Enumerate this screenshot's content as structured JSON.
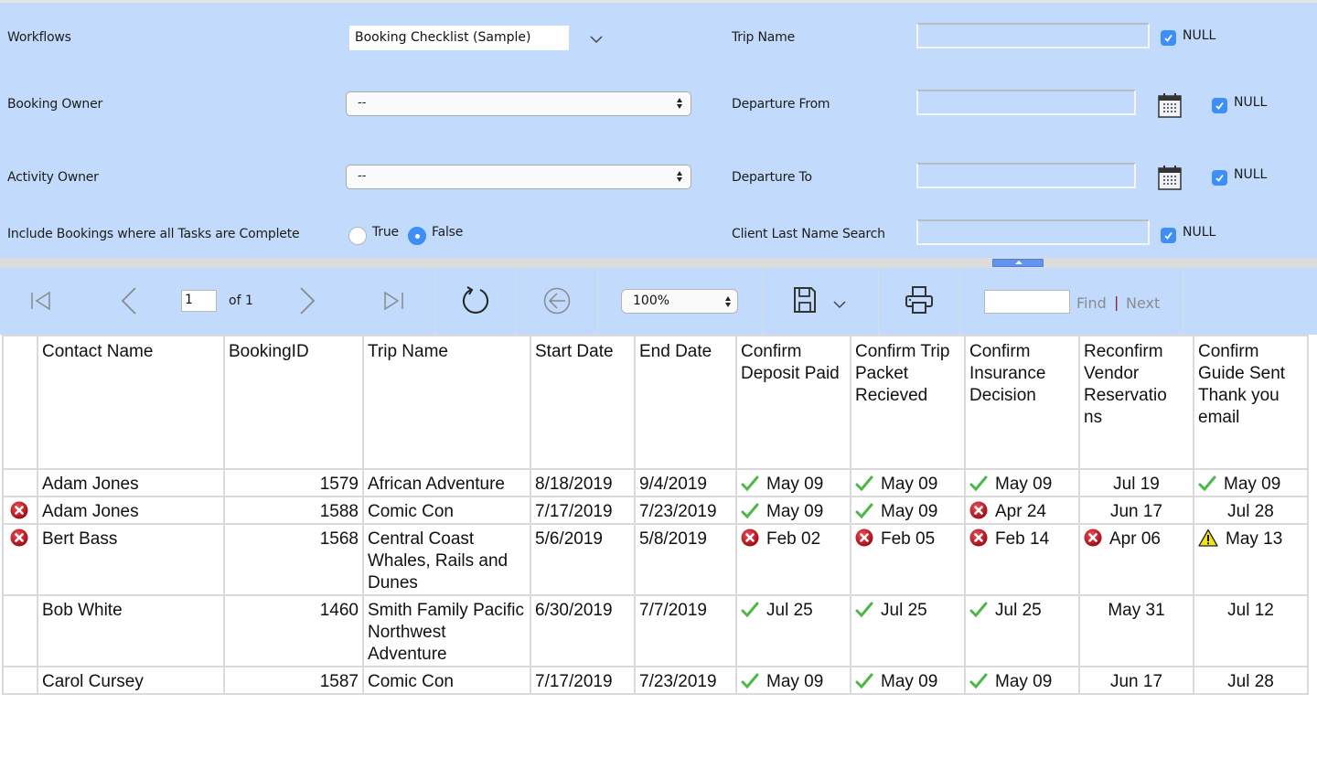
{
  "params": {
    "workflows": {
      "label": "Workflows",
      "value": "Booking Checklist (Sample)"
    },
    "booking_owner": {
      "label": "Booking Owner",
      "value": "--"
    },
    "activity_owner": {
      "label": "Activity Owner",
      "value": "--"
    },
    "include_complete": {
      "label": "Include Bookings where all Tasks are Complete",
      "options": [
        "True",
        "False"
      ],
      "selected": "False"
    },
    "trip_name": {
      "label": "Trip Name",
      "value": "",
      "null_label": "NULL",
      "null_checked": true
    },
    "departure_from": {
      "label": "Departure From",
      "value": "",
      "null_label": "NULL",
      "null_checked": true
    },
    "departure_to": {
      "label": "Departure To",
      "value": "",
      "null_label": "NULL",
      "null_checked": true
    },
    "client_last_name": {
      "label": "Client Last Name Search",
      "value": "",
      "null_label": "NULL",
      "null_checked": true
    }
  },
  "toolbar": {
    "page_current": "1",
    "page_of": "of 1",
    "zoom": "100%",
    "find_value": "",
    "find_label": "Find",
    "separator": "|",
    "next_label": "Next"
  },
  "table": {
    "columns": [
      "",
      "Contact Name",
      "BookingID",
      "Trip Name",
      "Start Date",
      "End Date",
      "Confirm Deposit Paid",
      "Confirm Trip Packet Recieved",
      "Confirm Insurance Decision",
      "Reconfirm Vendor Reservatio ns",
      "Confirm Guide Sent Thank you email"
    ],
    "rows": [
      {
        "status": "none",
        "contact": "Adam Jones",
        "booking_id": "1579",
        "trip": "African Adventure",
        "start": "8/18/2019",
        "end": "9/4/2019",
        "tasks": [
          {
            "icon": "check",
            "date": "May 09"
          },
          {
            "icon": "check",
            "date": "May 09"
          },
          {
            "icon": "check",
            "date": "May 09"
          },
          {
            "icon": "none",
            "date": "Jul 19"
          },
          {
            "icon": "check",
            "date": "May 09"
          }
        ]
      },
      {
        "status": "error",
        "contact": "Adam Jones",
        "booking_id": "1588",
        "trip": "Comic Con",
        "start": "7/17/2019",
        "end": "7/23/2019",
        "tasks": [
          {
            "icon": "check",
            "date": "May 09"
          },
          {
            "icon": "check",
            "date": "May 09"
          },
          {
            "icon": "error",
            "date": "Apr 24"
          },
          {
            "icon": "none",
            "date": "Jun 17"
          },
          {
            "icon": "none",
            "date": "Jul 28"
          }
        ]
      },
      {
        "status": "error",
        "contact": "Bert Bass",
        "booking_id": "1568",
        "trip": "Central Coast Whales, Rails and Dunes",
        "start": "5/6/2019",
        "end": "5/8/2019",
        "tasks": [
          {
            "icon": "error",
            "date": "Feb 02"
          },
          {
            "icon": "error",
            "date": "Feb 05"
          },
          {
            "icon": "error",
            "date": "Feb 14"
          },
          {
            "icon": "error",
            "date": "Apr 06"
          },
          {
            "icon": "warning",
            "date": "May 13"
          }
        ]
      },
      {
        "status": "none",
        "contact": "Bob White",
        "booking_id": "1460",
        "trip": "Smith Family Pacific Northwest Adventure",
        "start": "6/30/2019",
        "end": "7/7/2019",
        "tasks": [
          {
            "icon": "check",
            "date": "Jul 25"
          },
          {
            "icon": "check",
            "date": "Jul 25"
          },
          {
            "icon": "check",
            "date": "Jul 25"
          },
          {
            "icon": "none",
            "date": "May 31"
          },
          {
            "icon": "none",
            "date": "Jul 12"
          }
        ]
      },
      {
        "status": "none",
        "contact": "Carol Cursey",
        "booking_id": "1587",
        "trip": "Comic Con",
        "start": "7/17/2019",
        "end": "7/23/2019",
        "tasks": [
          {
            "icon": "check",
            "date": "May 09"
          },
          {
            "icon": "check",
            "date": "May 09"
          },
          {
            "icon": "check",
            "date": "May 09"
          },
          {
            "icon": "none",
            "date": "Jun 17"
          },
          {
            "icon": "none",
            "date": "Jul 28"
          }
        ]
      }
    ]
  },
  "colors": {
    "panel_bg": "#c2dbfd",
    "accent": "#3d8ff5",
    "check": "#4cb848",
    "error": "#c8141c",
    "warning": "#f5e31a"
  }
}
